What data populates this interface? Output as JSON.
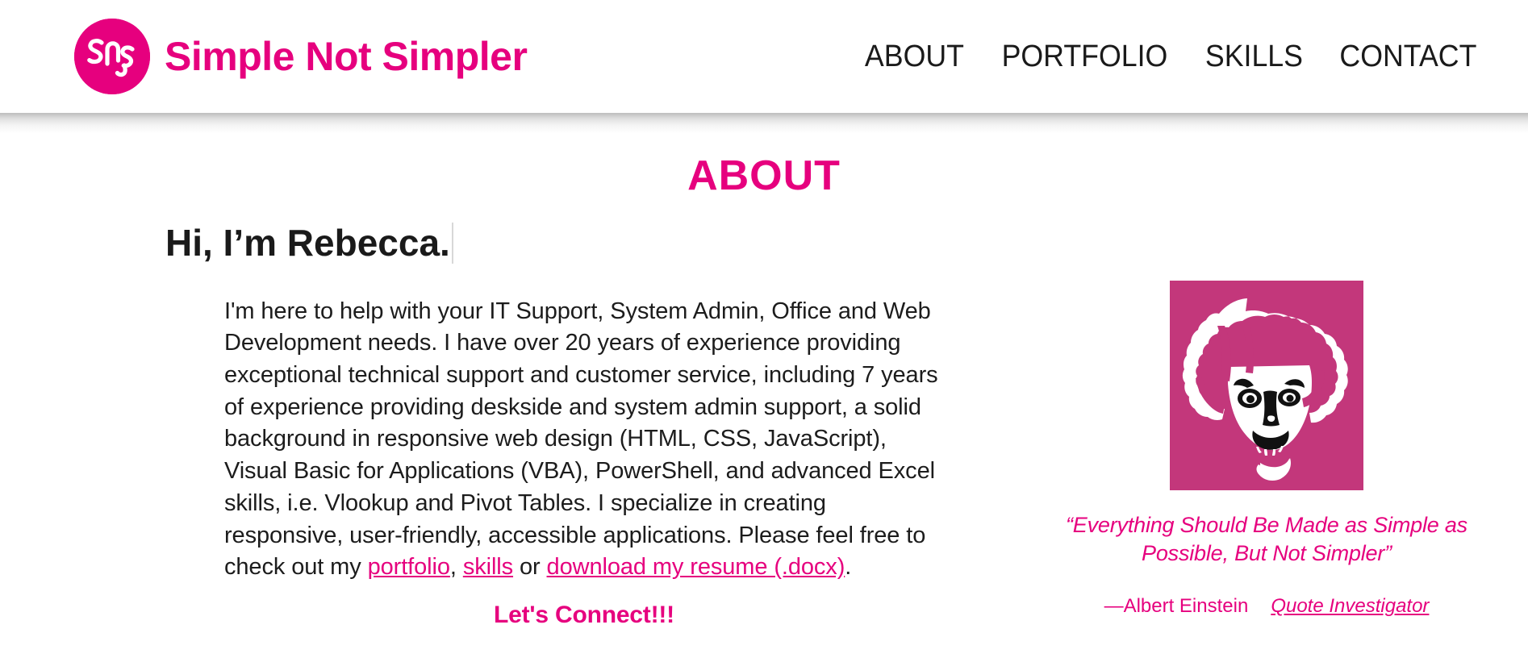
{
  "brand": {
    "logo_icon": "sns-monogram-icon",
    "logo_text": "Sns",
    "name": "Simple Not Simpler",
    "color": "#E6007E"
  },
  "nav": {
    "items": [
      {
        "label": "ABOUT"
      },
      {
        "label": "PORTFOLIO"
      },
      {
        "label": "SKILLS"
      },
      {
        "label": "CONTACT"
      }
    ]
  },
  "main": {
    "page_title": "ABOUT",
    "intro_heading": "Hi, I’m Rebecca.",
    "bio": {
      "part1": "I'm here to help with your IT Support, System Admin, Office and Web Development needs. I have over 20 years of experience providing exceptional technical support and customer service, including 7 years of experience providing deskside and system admin support, a solid background in responsive web design (HTML, CSS, JavaScript), Visual Basic for Applications (VBA), PowerShell, and advanced Excel skills, i.e. Vlookup and Pivot Tables. I specialize in creating responsive, user-friendly, accessible applications. Please feel free to check out my ",
      "link_portfolio": "portfolio",
      "separator_comma": ", ",
      "link_skills": "skills",
      "separator_or": " or ",
      "link_resume": "download my resume (.docx)",
      "end_period": "."
    },
    "connect_text": "Let's Connect!!!"
  },
  "aside": {
    "portrait_icon": "einstein-portrait-icon",
    "portrait_bg": "#C3377B",
    "quote": "“Everything Should Be Made as Simple as Possible, But Not Simpler”",
    "attribution": "—Albert Einstein",
    "source_link": "Quote Investigator"
  }
}
